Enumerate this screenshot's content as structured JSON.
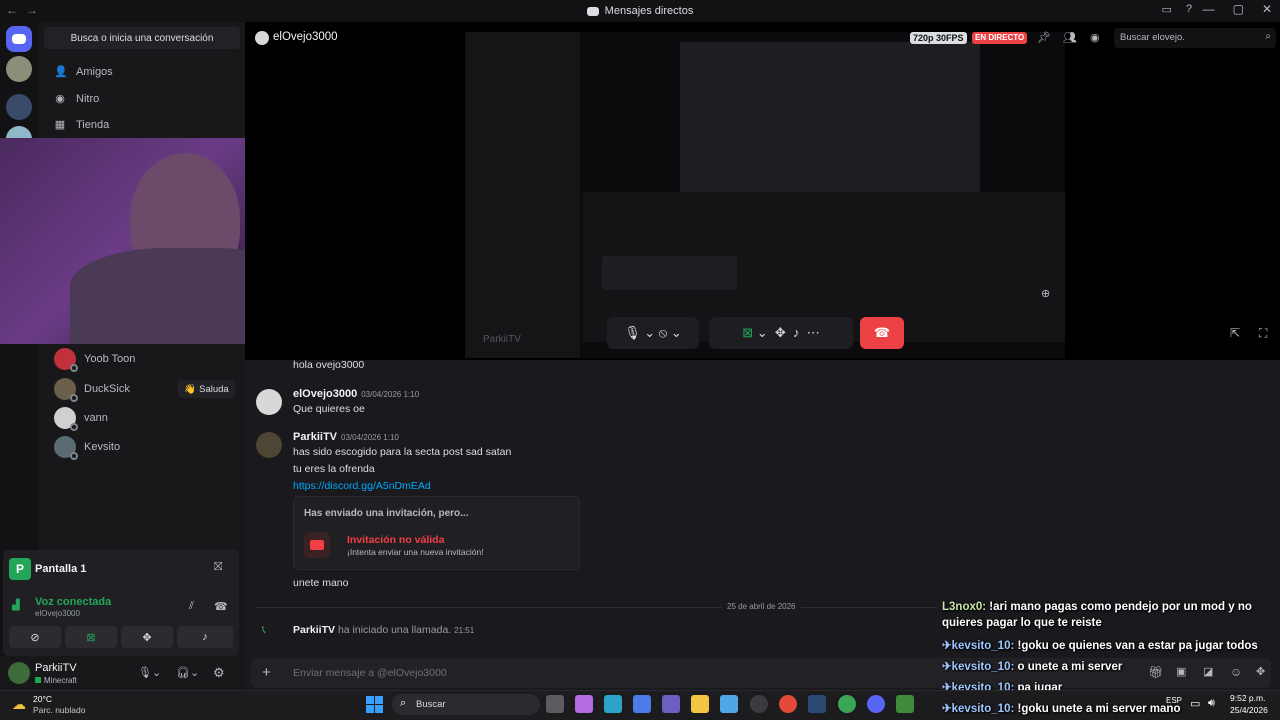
{
  "window": {
    "title": "Mensajes directos",
    "title_icon": "discord-icon"
  },
  "sidebar": {
    "search_label": "Busca o inicia una conversación",
    "nav": [
      {
        "label": "Amigos",
        "icon": "friends-icon"
      },
      {
        "label": "Nitro",
        "icon": "nitro-icon"
      },
      {
        "label": "Tienda",
        "icon": "store-icon"
      }
    ],
    "dms": [
      {
        "name": "Yoob Toon",
        "color": "#c0313b"
      },
      {
        "name": "DuckSick",
        "color": "#6b5e4b"
      },
      {
        "name": "vann",
        "color": "#d0d0d0"
      },
      {
        "name": "Kevsito",
        "color": "#5a6b73"
      }
    ],
    "wave_button": "Saluda",
    "wave_icon": "wave-emoji"
  },
  "voice_panel": {
    "stream_title": "Pantalla 1",
    "status": "Voz conectada",
    "channel": "elOvejo3000"
  },
  "user_bar": {
    "username": "ParkiiTV",
    "activity": "Minecraft"
  },
  "header": {
    "channel_name": "elOvejo3000",
    "quality_badge": "720p 30FPS",
    "live_badge": "EN DIRECTO",
    "search_placeholder": "Buscar elovejo."
  },
  "stream": {
    "watermark": "ParkiiTV"
  },
  "messages": [
    {
      "text": "hola ovejo3000"
    },
    {
      "author": "elOvejo3000",
      "timestamp": "03/04/2026 1:10",
      "lines": [
        "Que quieres oe"
      ]
    },
    {
      "author": "ParkiiTV",
      "timestamp": "03/04/2026 1:10",
      "lines": [
        "has sido escogido para la secta post sad satan",
        "tu eres la ofrenda"
      ],
      "link": "https://discord.gg/A5nDmEAd"
    }
  ],
  "invite": {
    "heading": "Has enviado una invitación, pero...",
    "title": "Invitación no válida",
    "subtitle": "¡Intenta enviar una nueva invitación!"
  },
  "after_invite": "unete mano",
  "date_divider": "25 de abril de 2026",
  "call_event": {
    "author": "ParkiiTV",
    "text": "ha iniciado una llamada.",
    "time": "21:51"
  },
  "composer": {
    "placeholder": "Enviar mensaje a @elOvejo3000"
  },
  "chat_overlay": [
    {
      "user": "L3nox0:",
      "text": "!ari mano pagas como pendejo por un mod y no"
    },
    {
      "user": "",
      "text": "quieres pagar lo que te reiste"
    },
    {
      "user": "kevsito_10:",
      "text": "!goku oe quienes van a estar pa jugar todos"
    },
    {
      "user": "kevsito_10:",
      "text": "o unete a mi server"
    },
    {
      "user": "kevsito_10:",
      "text": "pa jugar"
    },
    {
      "user": "kevsito_10:",
      "text": "!goku unete a mi server mano"
    }
  ],
  "taskbar": {
    "weather_temp": "20°C",
    "weather_desc": "Parc. nublado",
    "search": "Buscar",
    "lang": "ESP",
    "time": "9:52 p.m.",
    "date": "25/4/2026"
  },
  "colors": {
    "accent": "#5865f2",
    "live_red": "#ed4245",
    "green": "#23a55a",
    "link": "#00a8fc",
    "invalid_red": "#f23f43"
  }
}
